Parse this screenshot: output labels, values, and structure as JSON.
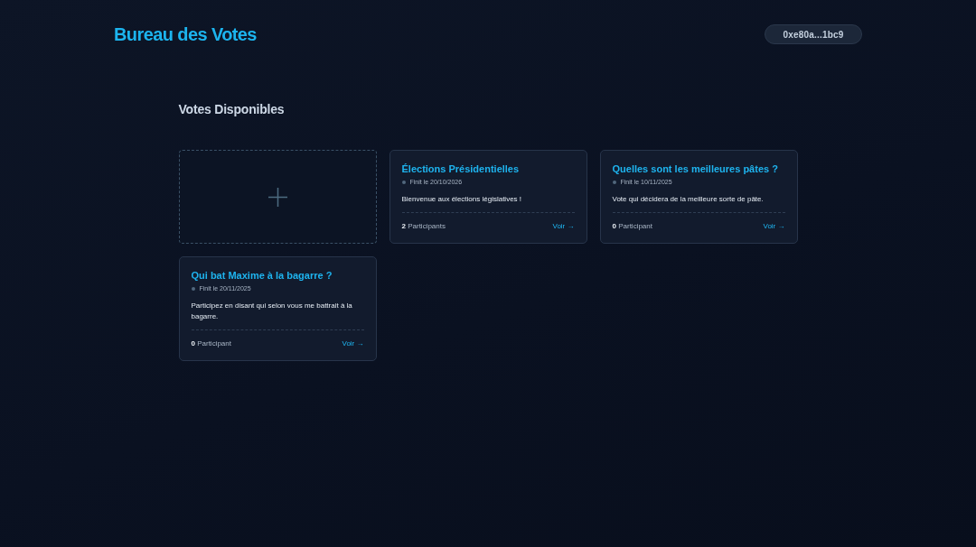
{
  "header": {
    "title": "Bureau des Votes",
    "wallet": "0xe80a...1bc9"
  },
  "section": {
    "title": "Votes Disponibles"
  },
  "create_card": {
    "kind": "add"
  },
  "votes": [
    {
      "title": "Élections Présidentielles",
      "date": "Finit le 20/10/2026",
      "description": "Bienvenue aux élections législatives !",
      "participants": "**2** Participants",
      "link": "Voir →"
    },
    {
      "title": "Quelles sont les meilleures pâtes ?",
      "date": "Finit le 10/11/2025",
      "description": "Vote qui décidera de la meilleure sorte de pâte.",
      "participants": "**0** Participant",
      "link": "Voir →"
    },
    {
      "title": "Qui bat Maxime à la bagarre ?",
      "date": "Finit le 20/11/2025",
      "description": "Participez en disant qui selon vous me battrait à la bagarre.",
      "participants": "**0** Participant",
      "link": "Voir →"
    }
  ]
}
